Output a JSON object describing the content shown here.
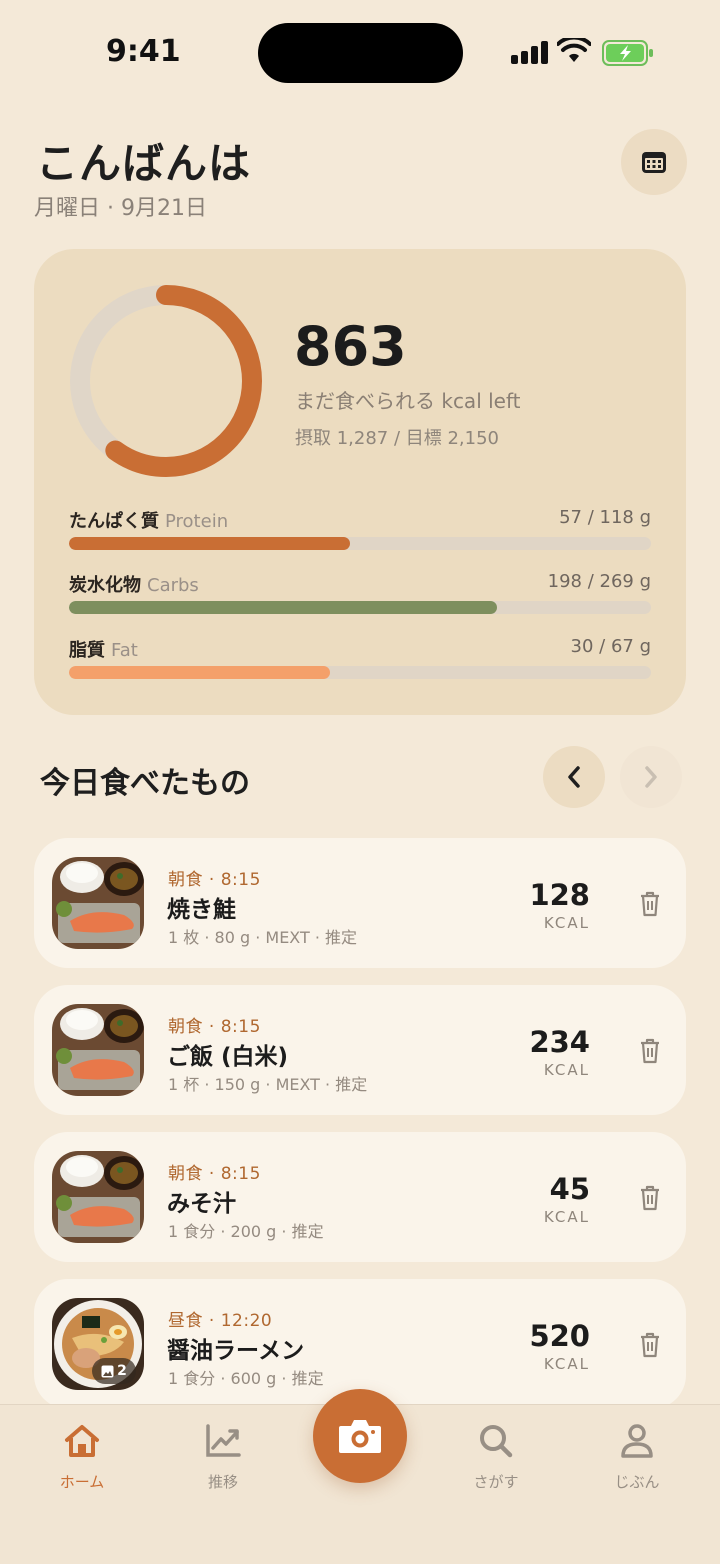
{
  "status": {
    "time": "9:41"
  },
  "header": {
    "greeting": "こんばんは",
    "date": "月曜日 · 9月21日"
  },
  "summary": {
    "remaining_kcal": "863",
    "remaining_label": "まだ食べられる kcal left",
    "intake_line": "摂取 1,287 / 目標 2,150",
    "ring_progress": 0.6,
    "macros": [
      {
        "name": "たんぱく質",
        "en": "Protein",
        "value": "57 / 118 g",
        "fraction": 0.483,
        "color": "#c96e34"
      },
      {
        "name": "炭水化物",
        "en": "Carbs",
        "value": "198 / 269 g",
        "fraction": 0.736,
        "color": "#7e8f5e"
      },
      {
        "name": "脂質",
        "en": "Fat",
        "value": "30 / 67 g",
        "fraction": 0.448,
        "color": "#f4a06a"
      }
    ]
  },
  "section": {
    "title": "今日食べたもの"
  },
  "foods": [
    {
      "meal": "朝食 · 8:15",
      "name": "焼き鮭",
      "detail": "1 枚 · 80 g · MEXT · 推定",
      "kcal": "128",
      "unit": "KCAL"
    },
    {
      "meal": "朝食 · 8:15",
      "name": "ご飯 (白米)",
      "detail": "1 杯 · 150 g · MEXT · 推定",
      "kcal": "234",
      "unit": "KCAL"
    },
    {
      "meal": "朝食 · 8:15",
      "name": "みそ汁",
      "detail": "1 食分 · 200 g · 推定",
      "kcal": "45",
      "unit": "KCAL"
    },
    {
      "meal": "昼食 · 12:20",
      "name": "醤油ラーメン",
      "detail": "1 食分 · 600 g · 推定",
      "kcal": "520",
      "unit": "KCAL",
      "photo_count": "2"
    }
  ],
  "tabs": [
    {
      "label": "ホーム",
      "icon": "home-icon"
    },
    {
      "label": "推移",
      "icon": "chart-icon"
    },
    {
      "label": "さがす",
      "icon": "search-icon"
    },
    {
      "label": "じぶん",
      "icon": "person-icon"
    }
  ],
  "colors": {
    "accent": "#c96e34",
    "background": "#f4e9d8",
    "card": "#ecdcc0"
  }
}
